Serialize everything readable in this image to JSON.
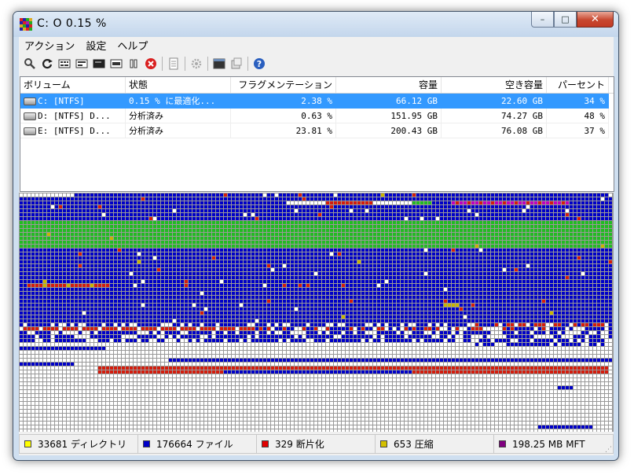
{
  "window": {
    "title": "C:  O   0.15 %"
  },
  "title_controls": {
    "minimize": "–",
    "maximize": "□",
    "close": "✕"
  },
  "menu": [
    "アクション",
    "設定",
    "ヘルプ"
  ],
  "toolbar_icons": [
    "magnifier-icon",
    "refresh-icon",
    "defrag-icon",
    "defrag-quick-icon",
    "defrag-full-icon",
    "optimize-icon",
    "pause-icon",
    "stop-icon",
    "report-icon",
    "settings-icon",
    "console-icon",
    "tasks-icon",
    "help-icon"
  ],
  "columns": [
    "ボリューム",
    "状態",
    "フラグメンテーション",
    "容量",
    "空き容量",
    "パーセント"
  ],
  "volumes": [
    {
      "name": "C: [NTFS]",
      "status": "0.15 % に最適化...",
      "fragmentation": "2.38 %",
      "capacity": "66.12 GB",
      "free": "22.60 GB",
      "percent": "34 %",
      "selected": true
    },
    {
      "name": "D: [NTFS]  D...",
      "status": "分析済み",
      "fragmentation": "0.63 %",
      "capacity": "151.95 GB",
      "free": "74.27 GB",
      "percent": "48 %",
      "selected": false
    },
    {
      "name": "E: [NTFS]  D...",
      "status": "分析済み",
      "fragmentation": "23.81 %",
      "capacity": "200.43 GB",
      "free": "76.08 GB",
      "percent": "37 %",
      "selected": false
    }
  ],
  "legend": [
    {
      "label": "33681 ディレクトリ",
      "color": "#ffff00"
    },
    {
      "label": "176664 ファイル",
      "color": "#0000c8"
    },
    {
      "label": "329 断片化",
      "color": "#e00000"
    },
    {
      "label": "653 圧縮",
      "color": "#d4c000"
    },
    {
      "label": "198.25 MB MFT",
      "color": "#800080"
    }
  ],
  "map_colors": {
    "free": "#ffffff",
    "file": "#0000c8",
    "fragmented": "#d41c0c",
    "mft": "#22bb22",
    "compressed": "#c8b400",
    "directory": "#eeee00",
    "system": "#c000c0"
  }
}
